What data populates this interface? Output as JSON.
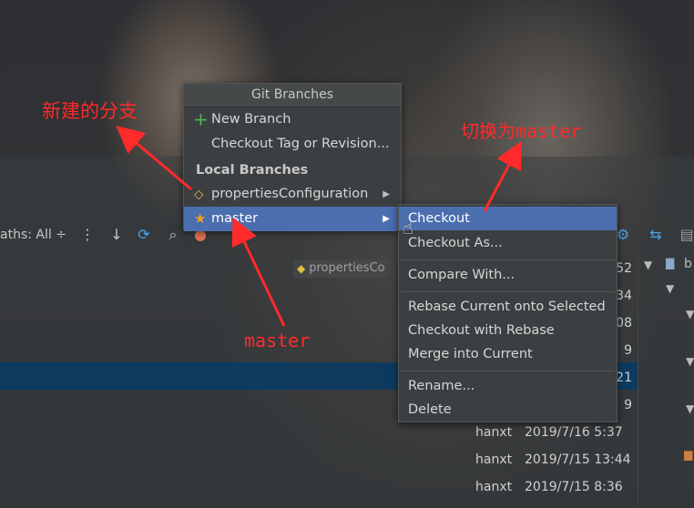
{
  "toolbar": {
    "paths_label": "aths: All ÷"
  },
  "tag_chip": {
    "label": "propertiesCo"
  },
  "popup": {
    "title": "Git Branches",
    "new_branch": "New Branch",
    "checkout_tag": "Checkout Tag or Revision...",
    "local_header": "Local Branches",
    "branches": [
      {
        "label": "propertiesConfiguration",
        "icon": "tag-icon"
      },
      {
        "label": "master",
        "icon": "star-icon"
      }
    ]
  },
  "submenu": {
    "items": [
      "Checkout",
      "Checkout As...",
      "Compare With...",
      "Rebase Current onto Selected",
      "Checkout with Rebase",
      "Merge into Current",
      "Rename...",
      "Delete"
    ]
  },
  "log": {
    "partial_times": [
      "52",
      "34",
      "08",
      "9",
      "21",
      "9"
    ],
    "rows": [
      {
        "author": "hanxt",
        "date": "2019/7/16 5:37"
      },
      {
        "author": "hanxt",
        "date": "2019/7/15 13:44"
      },
      {
        "author": "hanxt",
        "date": "2019/7/15 8:36"
      }
    ]
  },
  "tree": {
    "top_label": "b"
  },
  "annotations": {
    "new_branch_note": "新建的分支",
    "switch_note": "切换为master",
    "master_note": "master"
  },
  "colors": {
    "selection": "#4b6eaf",
    "annotation": "#ff2a2a",
    "menu_bg": "#3c3f41"
  }
}
